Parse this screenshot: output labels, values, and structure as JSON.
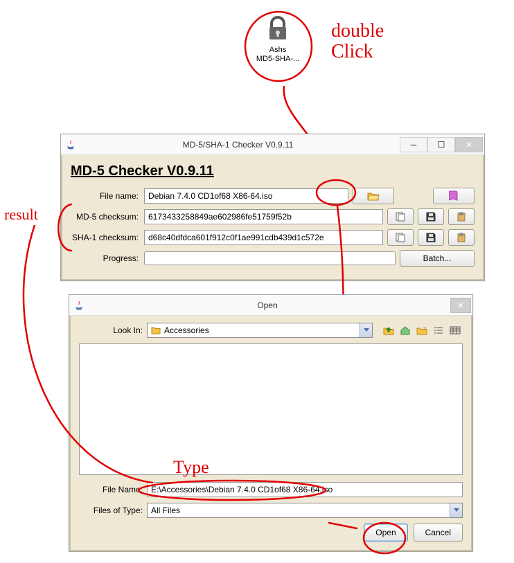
{
  "desktop_icon": {
    "name": "Ashs\nMD5-SHA-..."
  },
  "annotations": {
    "double_click": "double\nClick",
    "result": "result",
    "type": "Type"
  },
  "checker": {
    "window_title": "MD-5/SHA-1 Checker V0.9.11",
    "heading": "MD-5 Checker V0.9.11",
    "labels": {
      "file_name": "File name:",
      "md5": "MD-5 checksum:",
      "sha1": "SHA-1 checksum:",
      "progress": "Progress:"
    },
    "values": {
      "file_name": "Debian 7.4.0 CD1of68 X86-64.iso",
      "md5": "6173433258849ae602986fe51759f52b",
      "sha1": "d68c40dfdca601f912c0f1ae991cdb439d1c572e"
    },
    "batch_label": "Batch..."
  },
  "open_dlg": {
    "window_title": "Open",
    "look_in_label": "Look In:",
    "look_in_value": "Accessories",
    "file_name_label": "File Name:",
    "file_name_value": "E:\\Accessories\\Debian 7.4.0 CD1of68 X86-64.iso",
    "files_of_type_label": "Files of Type:",
    "files_of_type_value": "All Files",
    "open_btn": "Open",
    "cancel_btn": "Cancel"
  }
}
